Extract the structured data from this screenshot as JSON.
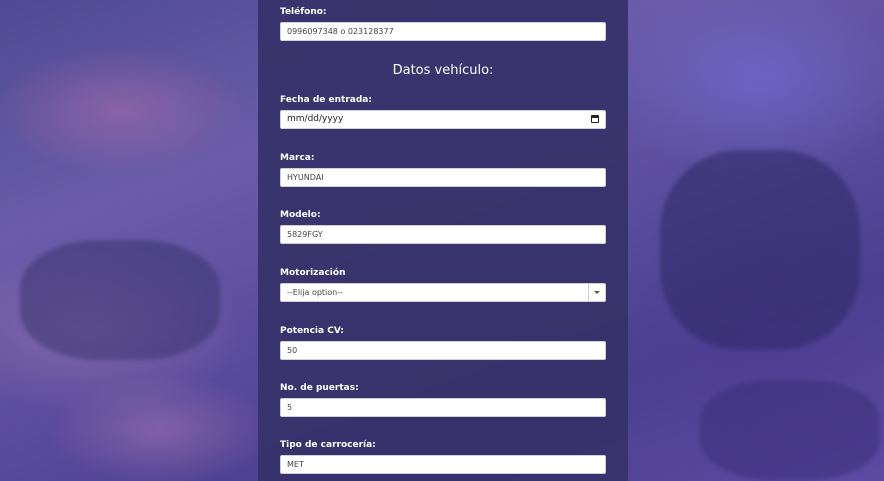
{
  "form": {
    "telefono": {
      "label": "Teléfono:",
      "value": "0996097348 o 023128377"
    },
    "section_title": "Datos vehículo:",
    "fecha_entrada": {
      "label": "Fecha de entrada:",
      "value": "mm/dd/yyyy"
    },
    "marca": {
      "label": "Marca:",
      "value": "HYUNDAI"
    },
    "modelo": {
      "label": "Modelo:",
      "value": "5829FGY"
    },
    "motorizacion": {
      "label": "Motorización",
      "selected": "--Elija option--"
    },
    "potencia": {
      "label": "Potencia CV:",
      "value": "50"
    },
    "puertas": {
      "label": "No. de puertas:",
      "value": "5"
    },
    "carroceria": {
      "label": "Tipo de carrocería:",
      "value": "MET"
    }
  },
  "colors": {
    "panel": "#37326a",
    "background": "#5a4c9c"
  },
  "icons": {
    "date_picker": "calendar-icon",
    "select": "chevron-down-icon"
  }
}
